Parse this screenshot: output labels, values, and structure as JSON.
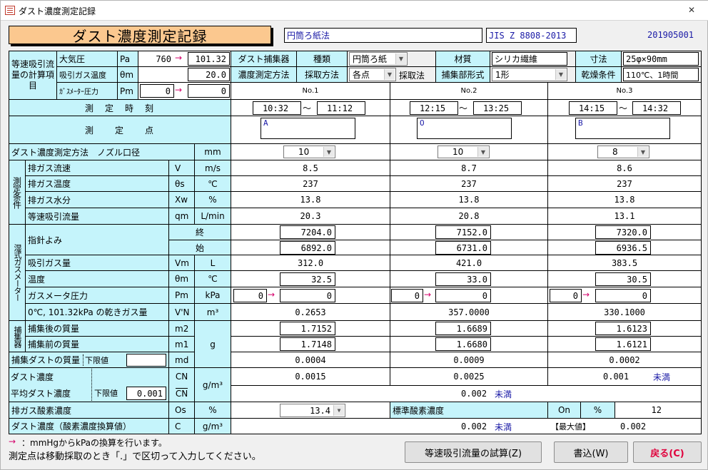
{
  "window": {
    "title": "ダスト濃度測定記録",
    "close_glyph": "✕"
  },
  "header": {
    "title": "ダスト濃度測定記録",
    "method": "円筒ろ紙法",
    "standard": "JIS Z 8808-2013",
    "record_id": "201905001"
  },
  "isokinetic": {
    "section_label": "等速吸引流量の計算項目",
    "atm_label": "大気圧",
    "atm_sym": "Pa",
    "atm_mmhg": "760",
    "atm_kpa": "101.32",
    "gas_temp_label": "吸引ガス温度",
    "gas_temp_sym": "θm",
    "gas_temp": "20.0",
    "meter_press_label": "ｶﾞｽﾒｰﾀｰ圧力",
    "meter_press_sym": "Pm",
    "meter_mmhg": "0",
    "meter_kpa": "0",
    "arrow": "→"
  },
  "collector": {
    "label": "ダスト捕集器",
    "type_label": "種類",
    "type_value": "円筒ろ紙",
    "material_label": "材質",
    "material_value": "シリカ繊維",
    "size_label": "寸法",
    "size_value": "25φ×90mm",
    "method_label": "濃度測定方法",
    "sampling_label": "採取方法",
    "sampling_value": "各点",
    "take_label": "採取法",
    "form_label": "捕集部形式",
    "form_value": "1形",
    "dry_label": "乾燥条件",
    "dry_value": "110℃、1時間"
  },
  "columns": [
    "No.1",
    "No.2",
    "No.3"
  ],
  "time": {
    "label": "測　定　時　刻",
    "tilde": "〜",
    "ranges": [
      [
        "10:32",
        "11:12"
      ],
      [
        "12:15",
        "13:25"
      ],
      [
        "14:15",
        "14:32"
      ]
    ]
  },
  "points": {
    "label": "測　　定　　点",
    "values": [
      "A",
      "O",
      "B"
    ]
  },
  "nozzle": {
    "label": "ダスト濃度測定方法　ノズル口径",
    "unit": "mm",
    "values": [
      "10",
      "10",
      "8"
    ]
  },
  "conditions": {
    "group_label": "測定条件",
    "rows": [
      {
        "label": "排ガス流速",
        "sym": "V",
        "unit": "m/s",
        "values": [
          "8.5",
          "8.7",
          "8.6"
        ]
      },
      {
        "label": "排ガス温度",
        "sym": "θs",
        "unit": "℃",
        "values": [
          "237",
          "237",
          "237"
        ]
      },
      {
        "label": "排ガス水分",
        "sym": "Xw",
        "unit": "%",
        "values": [
          "13.8",
          "13.8",
          "13.8"
        ]
      },
      {
        "label": "等速吸引流量",
        "sym": "qm",
        "unit": "L/min",
        "values": [
          "20.3",
          "20.8",
          "13.1"
        ]
      }
    ]
  },
  "gasmeter": {
    "group_label": "湿式ガスメーター",
    "pointer_label": "指針よみ",
    "end_label": "終",
    "start_label": "始",
    "end_values": [
      "7204.0",
      "7152.0",
      "7320.0"
    ],
    "start_values": [
      "6892.0",
      "6731.0",
      "6936.5"
    ],
    "volume_label": "吸引ガス量",
    "volume_sym": "Vm",
    "volume_unit": "L",
    "volume_values": [
      "312.0",
      "421.0",
      "383.5"
    ],
    "temp_label": "温度",
    "temp_sym": "θm",
    "temp_unit": "℃",
    "temp_values": [
      "32.5",
      "33.0",
      "30.5"
    ],
    "press_label": "ガスメータ圧力",
    "press_sym": "Pm",
    "press_unit": "kPa",
    "press_mmhg": [
      "0",
      "0",
      "0"
    ],
    "press_kpa": [
      "0",
      "0",
      "0"
    ],
    "dry_label": "0℃, 101.32kPa の乾きガス量",
    "dry_sym": "V'N",
    "dry_unit": "m³",
    "dry_values": [
      "0.2653",
      "357.0000",
      "330.1000"
    ]
  },
  "catcher": {
    "group_label": "捕集器",
    "after_label": "捕集後の質量",
    "after_sym": "m2",
    "after_values": [
      "1.7152",
      "1.6689",
      "1.6123"
    ],
    "before_label": "捕集前の質量",
    "before_sym": "m1",
    "before_values": [
      "1.7148",
      "1.6680",
      "1.6121"
    ],
    "unit": "g",
    "dust_label": "捕集ダストの質量",
    "lower_label": "下限値",
    "lower_value": "",
    "dust_sym": "md",
    "dust_values": [
      "0.0004",
      "0.0009",
      "0.0002"
    ]
  },
  "concentration": {
    "label": "ダスト濃度",
    "sym": "CN",
    "unit": "g/m³",
    "values": [
      "0.0015",
      "0.0025",
      "0.001"
    ],
    "note3": "未満",
    "avg_label": "平均ダスト濃度",
    "avg_lower_label": "下限値",
    "avg_lower_value": "0.001",
    "avg_sym": "CN",
    "avg_value": "0.002",
    "avg_note": "未満"
  },
  "oxygen": {
    "label": "排ガス酸素濃度",
    "sym": "Os",
    "unit": "%",
    "value": "13.4",
    "std_label": "標準酸素濃度",
    "std_sym": "On",
    "std_unit": "%",
    "std_value": "12"
  },
  "converted": {
    "label": "ダスト濃度（酸素濃度換算値）",
    "sym": "C",
    "unit": "g/m³",
    "value": "0.002",
    "note": "未満",
    "max_label": "【最大値】",
    "max_value": "0.002"
  },
  "footer": {
    "note1_arrow": "→",
    "note1": "：mmHgからkPaの換算を行います。",
    "note2": "測定点は移動採取のとき「.」で区切って入力してください。",
    "trial_button": "等速吸引流量の試算(Z)",
    "write_button": "書込(W)",
    "back_button": "戻る(C)"
  },
  "colors": {
    "header_orange": "#fbc88f",
    "cell_cyan": "#c5f4fb",
    "arrow_magenta": "#d4006a",
    "back_red": "#e0003c"
  }
}
